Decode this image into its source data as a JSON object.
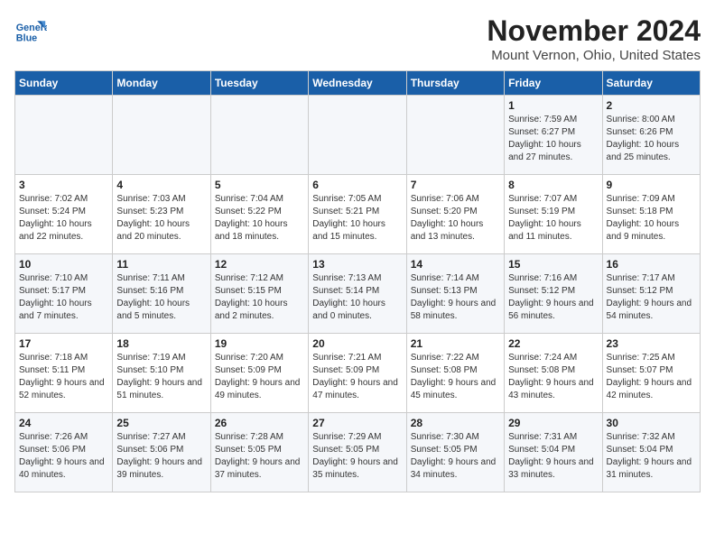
{
  "header": {
    "logo_line1": "General",
    "logo_line2": "Blue",
    "month": "November 2024",
    "location": "Mount Vernon, Ohio, United States"
  },
  "weekdays": [
    "Sunday",
    "Monday",
    "Tuesday",
    "Wednesday",
    "Thursday",
    "Friday",
    "Saturday"
  ],
  "weeks": [
    [
      {
        "day": "",
        "info": ""
      },
      {
        "day": "",
        "info": ""
      },
      {
        "day": "",
        "info": ""
      },
      {
        "day": "",
        "info": ""
      },
      {
        "day": "",
        "info": ""
      },
      {
        "day": "1",
        "info": "Sunrise: 7:59 AM\nSunset: 6:27 PM\nDaylight: 10 hours\nand 27 minutes."
      },
      {
        "day": "2",
        "info": "Sunrise: 8:00 AM\nSunset: 6:26 PM\nDaylight: 10 hours\nand 25 minutes."
      }
    ],
    [
      {
        "day": "3",
        "info": "Sunrise: 7:02 AM\nSunset: 5:24 PM\nDaylight: 10 hours\nand 22 minutes."
      },
      {
        "day": "4",
        "info": "Sunrise: 7:03 AM\nSunset: 5:23 PM\nDaylight: 10 hours\nand 20 minutes."
      },
      {
        "day": "5",
        "info": "Sunrise: 7:04 AM\nSunset: 5:22 PM\nDaylight: 10 hours\nand 18 minutes."
      },
      {
        "day": "6",
        "info": "Sunrise: 7:05 AM\nSunset: 5:21 PM\nDaylight: 10 hours\nand 15 minutes."
      },
      {
        "day": "7",
        "info": "Sunrise: 7:06 AM\nSunset: 5:20 PM\nDaylight: 10 hours\nand 13 minutes."
      },
      {
        "day": "8",
        "info": "Sunrise: 7:07 AM\nSunset: 5:19 PM\nDaylight: 10 hours\nand 11 minutes."
      },
      {
        "day": "9",
        "info": "Sunrise: 7:09 AM\nSunset: 5:18 PM\nDaylight: 10 hours\nand 9 minutes."
      }
    ],
    [
      {
        "day": "10",
        "info": "Sunrise: 7:10 AM\nSunset: 5:17 PM\nDaylight: 10 hours\nand 7 minutes."
      },
      {
        "day": "11",
        "info": "Sunrise: 7:11 AM\nSunset: 5:16 PM\nDaylight: 10 hours\nand 5 minutes."
      },
      {
        "day": "12",
        "info": "Sunrise: 7:12 AM\nSunset: 5:15 PM\nDaylight: 10 hours\nand 2 minutes."
      },
      {
        "day": "13",
        "info": "Sunrise: 7:13 AM\nSunset: 5:14 PM\nDaylight: 10 hours\nand 0 minutes."
      },
      {
        "day": "14",
        "info": "Sunrise: 7:14 AM\nSunset: 5:13 PM\nDaylight: 9 hours\nand 58 minutes."
      },
      {
        "day": "15",
        "info": "Sunrise: 7:16 AM\nSunset: 5:12 PM\nDaylight: 9 hours\nand 56 minutes."
      },
      {
        "day": "16",
        "info": "Sunrise: 7:17 AM\nSunset: 5:12 PM\nDaylight: 9 hours\nand 54 minutes."
      }
    ],
    [
      {
        "day": "17",
        "info": "Sunrise: 7:18 AM\nSunset: 5:11 PM\nDaylight: 9 hours\nand 52 minutes."
      },
      {
        "day": "18",
        "info": "Sunrise: 7:19 AM\nSunset: 5:10 PM\nDaylight: 9 hours\nand 51 minutes."
      },
      {
        "day": "19",
        "info": "Sunrise: 7:20 AM\nSunset: 5:09 PM\nDaylight: 9 hours\nand 49 minutes."
      },
      {
        "day": "20",
        "info": "Sunrise: 7:21 AM\nSunset: 5:09 PM\nDaylight: 9 hours\nand 47 minutes."
      },
      {
        "day": "21",
        "info": "Sunrise: 7:22 AM\nSunset: 5:08 PM\nDaylight: 9 hours\nand 45 minutes."
      },
      {
        "day": "22",
        "info": "Sunrise: 7:24 AM\nSunset: 5:08 PM\nDaylight: 9 hours\nand 43 minutes."
      },
      {
        "day": "23",
        "info": "Sunrise: 7:25 AM\nSunset: 5:07 PM\nDaylight: 9 hours\nand 42 minutes."
      }
    ],
    [
      {
        "day": "24",
        "info": "Sunrise: 7:26 AM\nSunset: 5:06 PM\nDaylight: 9 hours\nand 40 minutes."
      },
      {
        "day": "25",
        "info": "Sunrise: 7:27 AM\nSunset: 5:06 PM\nDaylight: 9 hours\nand 39 minutes."
      },
      {
        "day": "26",
        "info": "Sunrise: 7:28 AM\nSunset: 5:05 PM\nDaylight: 9 hours\nand 37 minutes."
      },
      {
        "day": "27",
        "info": "Sunrise: 7:29 AM\nSunset: 5:05 PM\nDaylight: 9 hours\nand 35 minutes."
      },
      {
        "day": "28",
        "info": "Sunrise: 7:30 AM\nSunset: 5:05 PM\nDaylight: 9 hours\nand 34 minutes."
      },
      {
        "day": "29",
        "info": "Sunrise: 7:31 AM\nSunset: 5:04 PM\nDaylight: 9 hours\nand 33 minutes."
      },
      {
        "day": "30",
        "info": "Sunrise: 7:32 AM\nSunset: 5:04 PM\nDaylight: 9 hours\nand 31 minutes."
      }
    ]
  ]
}
